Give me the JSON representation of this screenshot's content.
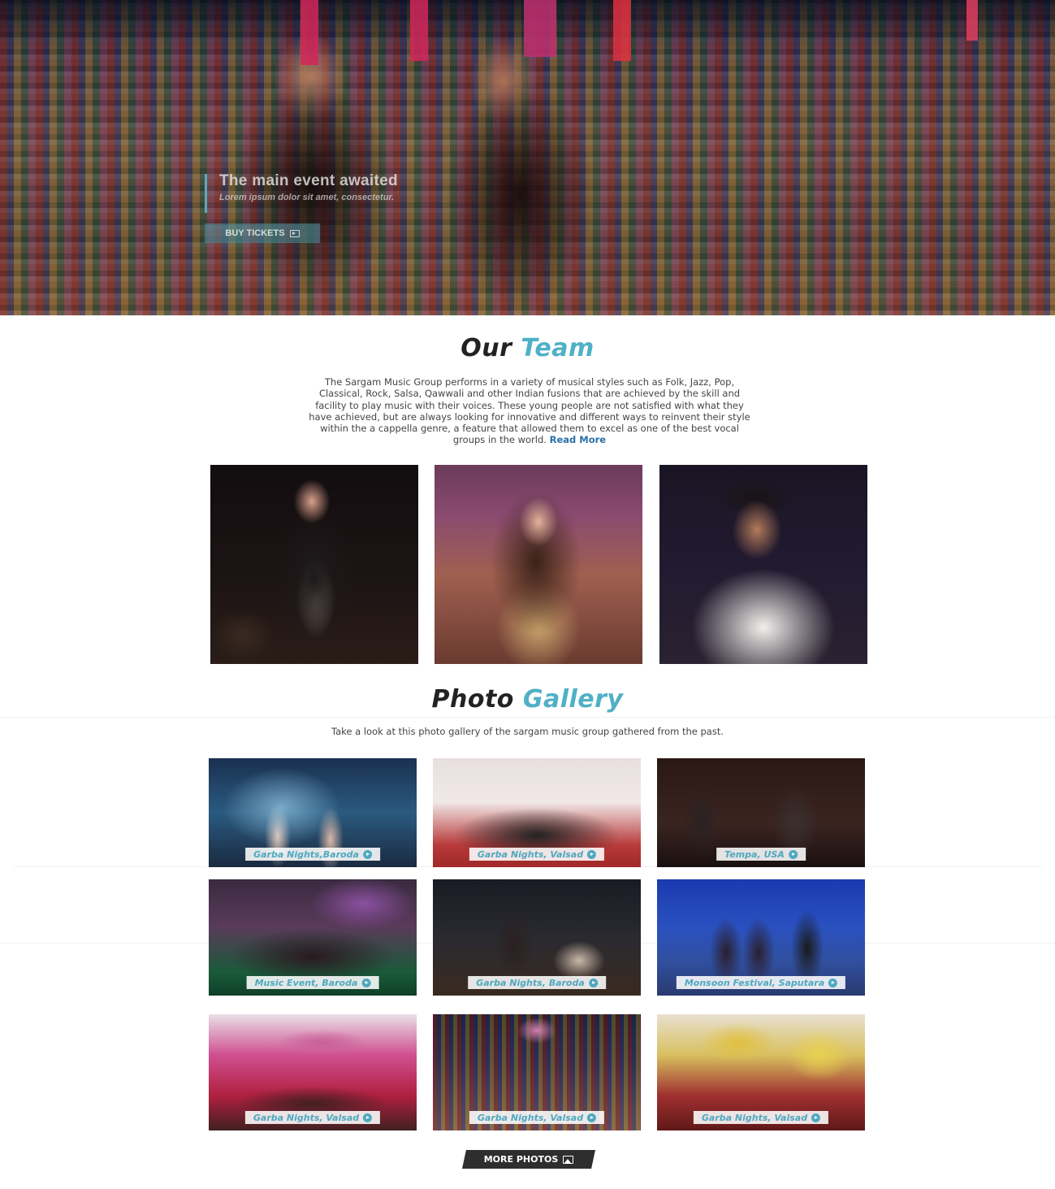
{
  "hero": {
    "title": "The main event awaited",
    "subtitle": "Lorem ipsum dolor sit amet, consectetur.",
    "button_label": "BUY TICKETS",
    "button_icon": "ticket-icon"
  },
  "team": {
    "heading_dark": "Our",
    "heading_accent": "Team",
    "description": "The Sargam Music Group performs in a variety of musical styles such as Folk, Jazz, Pop, Classical, Rock, Salsa, Qawwali and other Indian fusions that are achieved by the skill and facility to play music with their voices. These young people are not satisfied with what they have achieved, but are always looking for innovative and different ways to reinvent their style within the a cappella genre, a feature that allowed them to excel as one of the best vocal groups in the world.",
    "read_more": "Read More"
  },
  "gallery": {
    "heading_dark": "Photo",
    "heading_accent": "Gallery",
    "subtitle": "Take a look at this photo gallery of the sargam music group gathered from the past.",
    "items": [
      {
        "label": "Garba Nights,Baroda"
      },
      {
        "label": "Garba Nights, Valsad"
      },
      {
        "label": "Tempa, USA"
      },
      {
        "label": "Music Event, Baroda"
      },
      {
        "label": "Garba Nights, Baroda"
      },
      {
        "label": "Monsoon Festival, Saputara"
      },
      {
        "label": "Garba Nights, Valsad"
      },
      {
        "label": "Garba Nights, Valsad"
      },
      {
        "label": "Garba Nights, Valsad"
      }
    ],
    "more_button": "MORE PHOTOS",
    "more_icon": "image-icon"
  },
  "colors": {
    "accent": "#4fb0c6",
    "link": "#2a6fa8",
    "button_dark": "#2e2e2e"
  }
}
